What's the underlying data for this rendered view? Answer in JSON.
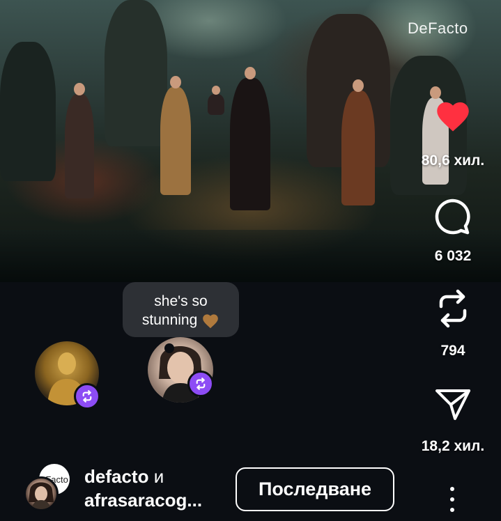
{
  "video": {
    "brand_watermark": "DeFacto"
  },
  "actions": {
    "like_count": "80,6 хил.",
    "comment_count": "6 032",
    "repost_count": "794",
    "share_count": "18,2 хил."
  },
  "comment_bubble": {
    "line1": "she's so",
    "line2": "stunning"
  },
  "author": {
    "primary": "defacto",
    "conjunction": " и",
    "secondary": "afrasaracog...",
    "follow_label": "Последване"
  },
  "colors": {
    "like": "#ff3040",
    "repost_badge": "#8d4cf5",
    "background": "#0b0e13",
    "bubble": "#2d3035"
  }
}
